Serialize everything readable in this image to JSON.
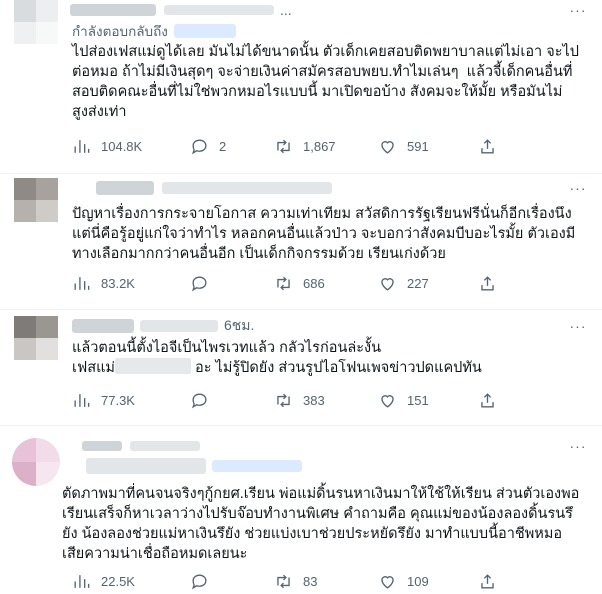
{
  "tweets": [
    {
      "replying_label": "กำลังตอบกลับถึง",
      "handle": "...",
      "text": "ไปส่องเฟสแม่ดูได้เลย มันไม่ได้ขนาดนั้น ตัวเด็กเคยสอบติดพยาบาลแต่ไม่เอา จะไปต่อหมอ ถ้าไม่มีเงินสุดๆ จะจ่ายเงินค่าสมัครสอบพยบ.ทำไมเล่นๆ  แล้วจี้เด็กคนอื่นที่สอบติดคณะอื่นที่ไม่ใช่พวกหมอไรแบบนี้ มาเปิดขอบ้าง สังคมจะให้มั้ย หรือมันไม่สูงส่งเท่า",
      "views": "104.8K",
      "replies": "2",
      "retweets": "1,867",
      "likes": "591"
    },
    {
      "text": "ปัญหาเรื่องการกระจายโอกาส ความเท่าเทียม สวัสดิการรัฐเรียนฟรีนั่นก็อีกเรื่องนึง แต่นี่คือรู้อยู่แก่ใจว่าทำไร หลอกคนอื่นแล้วป่าว จะบอกว่าสังคมบีบอะไรมั้ย ตัวเองมีทางเลือกมากกว่าคนอื่นอีก เป็นเด็กกิจกรรมด้วย เรียนเก่งด้วย",
      "views": "83.2K",
      "replies": "",
      "retweets": "686",
      "likes": "227"
    },
    {
      "time": "6ชม.",
      "line1": "แล้วตอนนี้ตั้งไอจีเป็นไพรเวทแล้ว กลัวไรก่อนล่ะงั้น",
      "line2_a": "เฟสแม่",
      "line2_b": " อะ ไม่รู้ปิดยัง ส่วนรูปไอโฟนเพจข่าวปดแคปทัน",
      "views": "77.3K",
      "replies": "",
      "retweets": "383",
      "likes": "151"
    },
    {
      "text": "ตัดภาพมาที่คนจนจริงๆกู้กยศ.เรียน พ่อแม่ดิ้นรนหาเงินมาให้ใช้ให้เรียน ส่วนตัวเองพอเรียนเสร็จก็หาเวลาว่างไปรับจ๊อบทำงานพิเศษ คำถามคือ คุณแม่ของน้องลองดิ้นรนรึยัง น้องลองช่วยแม่หาเงินรึยัง ช่วยแบ่งเบาช่วยประหยัดรึยัง มาทำแบบนี้อาชีพหมอเสียความน่าเชื่อถือหมดเลยนะ",
      "views": "22.5K",
      "replies": "",
      "retweets": "83",
      "likes": "109"
    }
  ],
  "icons": {
    "views": "bar-chart-icon",
    "reply": "speech-bubble-icon",
    "retweet": "retweet-icon",
    "like": "heart-icon",
    "share": "share-icon",
    "more": "more-dots-icon"
  },
  "colors": {
    "text": "#0f1419",
    "secondary": "#536471",
    "divider": "#eff3f4",
    "mention_bg": "#dbeafe"
  }
}
